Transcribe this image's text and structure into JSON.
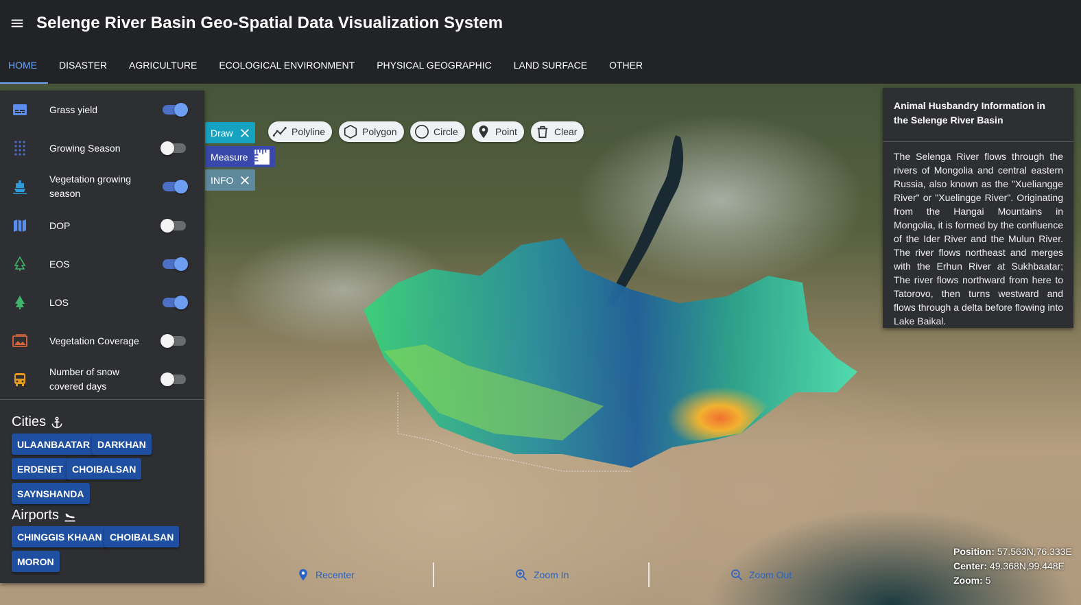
{
  "app": {
    "title": "Selenge River Basin Geo-Spatial Data Visualization System"
  },
  "tabs": [
    {
      "label": "HOME",
      "active": true
    },
    {
      "label": "DISASTER"
    },
    {
      "label": "AGRICULTURE"
    },
    {
      "label": "ECOLOGICAL ENVIRONMENT"
    },
    {
      "label": "PHYSICAL GEOGRAPHIC"
    },
    {
      "label": "LAND SURFACE"
    },
    {
      "label": "OTHER"
    }
  ],
  "layers": [
    {
      "label": "Grass yield",
      "icon": "subtitles-icon",
      "on": true
    },
    {
      "label": "Growing Season",
      "icon": "dots-grid-icon",
      "on": false
    },
    {
      "label": "Vegetation growing season",
      "icon": "ship-icon",
      "on": true
    },
    {
      "label": "DOP",
      "icon": "map-icon",
      "on": false
    },
    {
      "label": "EOS",
      "icon": "tree-outline-icon",
      "on": true
    },
    {
      "label": "LOS",
      "icon": "tree-icon",
      "on": true
    },
    {
      "label": "Vegetation Coverage",
      "icon": "image-area-icon",
      "on": false
    },
    {
      "label": "Number of snow covered days",
      "icon": "bus-icon",
      "on": false
    }
  ],
  "cities": {
    "title": "Cities",
    "icon": "anchor-icon",
    "items": [
      "ULAANBAATAR",
      "DARKHAN",
      "ERDENET",
      "CHOIBALSAN",
      "SAYNSHANDA"
    ]
  },
  "airports": {
    "title": "Airports",
    "icon": "airplane-landing-icon",
    "items": [
      "CHINGGIS KHAAN",
      "CHOIBALSAN",
      "MORON"
    ]
  },
  "draw_tools": {
    "draw_label": "Draw",
    "measure_label": "Measure",
    "info_label": "INFO",
    "tools": [
      {
        "label": "Polyline",
        "icon": "polyline-icon"
      },
      {
        "label": "Polygon",
        "icon": "hexagon-outline-icon"
      },
      {
        "label": "Circle",
        "icon": "circle-outline-icon"
      },
      {
        "label": "Point",
        "icon": "map-marker-icon"
      },
      {
        "label": "Clear",
        "icon": "trash-icon"
      }
    ]
  },
  "info_panel": {
    "title": "Animal Husbandry Information in the Selenge River Basin",
    "body": "The Selenga River flows through the rivers of Mongolia and central eastern Russia, also known as the \"Xueliangge River\" or \"Xuelingge River\". Originating from the Hangai Mountains in Mongolia, it is formed by the confluence of the Ider River and the Mulun River. The river flows northeast and merges with the Erhun River at Sukhbaatar; The river flows northward from here to Tatorovo, then turns westward and flows through a delta before flowing into Lake Baikal."
  },
  "map_nav": {
    "recenter": "Recenter",
    "zoom_in": "Zoom In",
    "zoom_out": "Zoom Out"
  },
  "coords": {
    "position_label": "Position:",
    "position_value": "57.563N,76.333E",
    "center_label": "Center:",
    "center_value": "49.368N,99.448E",
    "zoom_label": "Zoom:",
    "zoom_value": "5"
  },
  "colors": {
    "accent": "#6ea3f5",
    "panel": "#2e2f33",
    "header": "#222326",
    "city_button": "#1f4fa0",
    "draw_chip": "#16a3c2",
    "measure_chip": "#3949ab",
    "info_chip": "#5f8a9e"
  }
}
